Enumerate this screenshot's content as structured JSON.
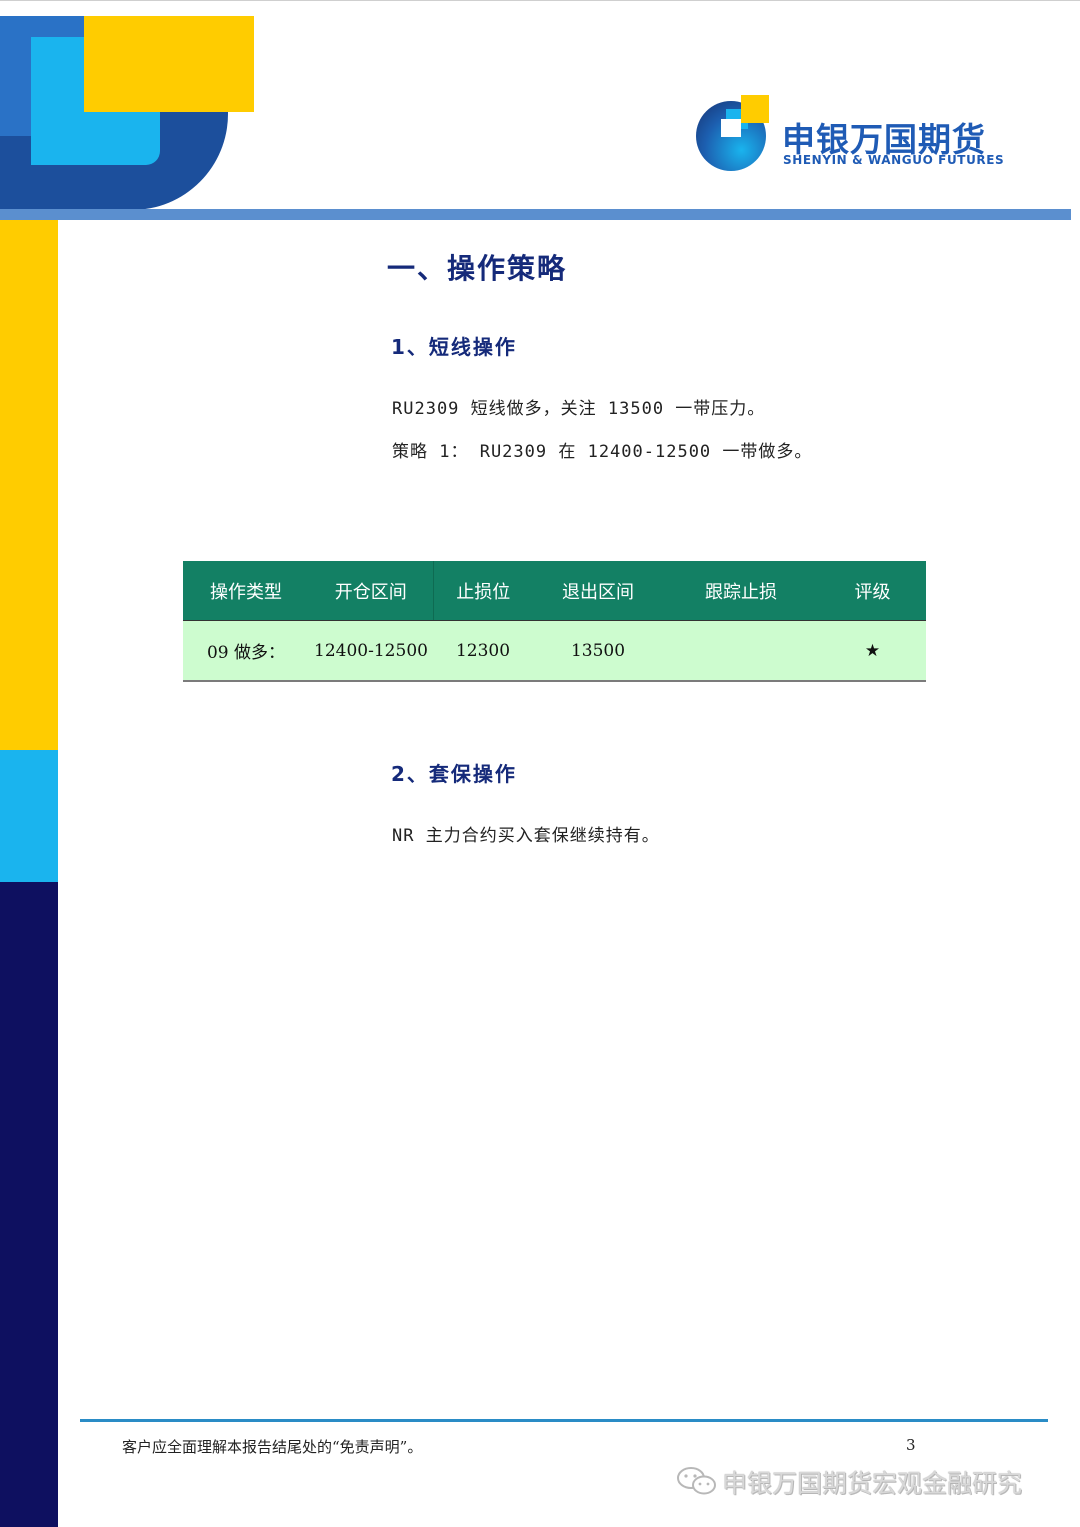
{
  "header": {
    "logo_cn": "申银万国期货",
    "logo_en": "SHENYIN & WANGUO FUTURES"
  },
  "section1": {
    "title": "一、操作策略",
    "sub1": {
      "title": "1、短线操作",
      "lines": [
        "RU2309 短线做多，关注 13500 一带压力。",
        "策略 1：  RU2309 在 12400-12500 一带做多。"
      ]
    },
    "table": {
      "headers": [
        "操作类型",
        "开仓区间",
        "止损位",
        "退出区间",
        "跟踪止损",
        "评级"
      ],
      "rows": [
        [
          "09 做多：",
          "12400-12500",
          "12300",
          "13500",
          "",
          "★"
        ]
      ]
    },
    "sub2": {
      "title": "2、套保操作",
      "lines": [
        "NR 主力合约买入套保继续持有。"
      ]
    }
  },
  "footer": {
    "note": "客户应全面理解本报告结尾处的“免责声明”。",
    "page": "3",
    "watermark": "申银万国期货宏观金融研究"
  },
  "colors": {
    "yellow": "#ffcc00",
    "cyan": "#1ab4ee",
    "navy": "#0e1060",
    "table_header": "#138064",
    "table_row": "#cdfccf",
    "heading": "#152a7a"
  }
}
